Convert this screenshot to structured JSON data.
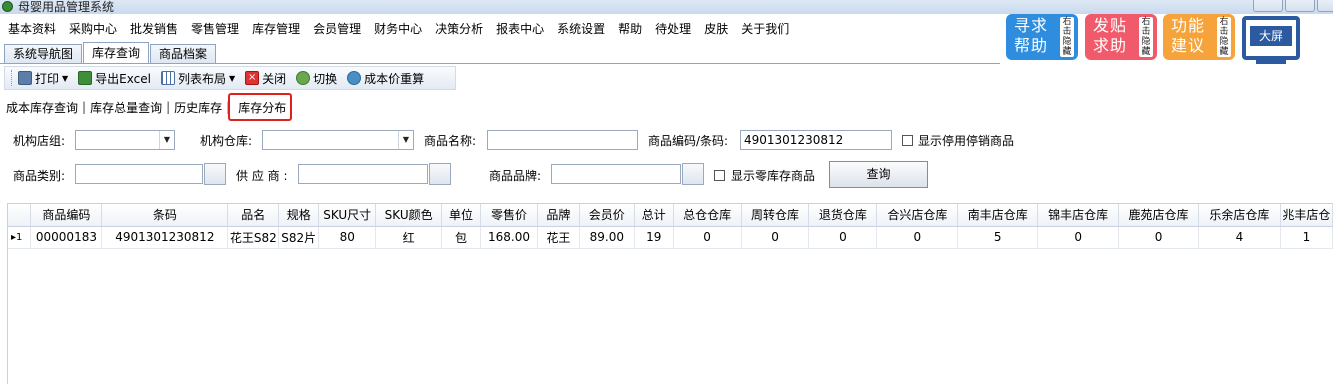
{
  "window": {
    "title": "母婴用品管理系统"
  },
  "menu": [
    "基本资料",
    "采购中心",
    "批发销售",
    "零售管理",
    "库存管理",
    "会员管理",
    "财务中心",
    "决策分析",
    "报表中心",
    "系统设置",
    "帮助",
    "待处理",
    "皮肤",
    "关于我们"
  ],
  "main_tabs": [
    {
      "label": "系统导航图",
      "active": false
    },
    {
      "label": "库存查询",
      "active": true
    },
    {
      "label": "商品档案",
      "active": false
    }
  ],
  "toolbar": {
    "print": "打印",
    "export": "导出Excel",
    "layout": "列表布局",
    "close": "关闭",
    "switch": "切换",
    "recalc": "成本价重算"
  },
  "sub_tabs": [
    {
      "label": "成本库存查询",
      "active": false
    },
    {
      "label": "库存总量查询",
      "active": false
    },
    {
      "label": "历史库存",
      "active": false
    },
    {
      "label": "库存分布",
      "active": true
    }
  ],
  "filters": {
    "org_group_label": "机构店组:",
    "org_group_value": "",
    "org_warehouse_label": "机构仓库:",
    "org_warehouse_value": "",
    "product_name_label": "商品名称:",
    "product_name_value": "",
    "code_label": "商品编码/条码:",
    "code_value": "4901301230812",
    "show_discontinued_label": "显示停用停销商品",
    "category_label": "商品类别:",
    "category_value": "",
    "supplier_label": "供 应 商 :",
    "supplier_value": "",
    "brand_label": "商品品牌:",
    "brand_value": "",
    "show_zero_label": "显示零库存商品",
    "query_button": "查询"
  },
  "table": {
    "columns": [
      "商品编码",
      "条码",
      "品名",
      "规格",
      "SKU尺寸",
      "SKU颜色",
      "单位",
      "零售价",
      "品牌",
      "会员价",
      "总计",
      "总仓仓库",
      "周转仓库",
      "退货仓库",
      "合兴店仓库",
      "南丰店仓库",
      "锦丰店仓库",
      "鹿苑店仓库",
      "乐余店仓库",
      "兆丰店仓"
    ],
    "rows": [
      {
        "indicator": "▸1",
        "cells": [
          "00000183",
          "4901301230812",
          "花王S82",
          "S82片",
          "80",
          "红",
          "包",
          "168.00",
          "花王",
          "89.00",
          "19",
          "0",
          "0",
          "0",
          "0",
          "5",
          "0",
          "0",
          "4",
          "1"
        ]
      }
    ]
  },
  "side_cards": [
    {
      "big": "寻求帮助",
      "small": "右击隐藏"
    },
    {
      "big": "发贴求助",
      "small": "右击隐藏"
    },
    {
      "big": "功能建议",
      "small": "右击隐藏"
    }
  ],
  "big_screen": {
    "label": "大屏"
  }
}
